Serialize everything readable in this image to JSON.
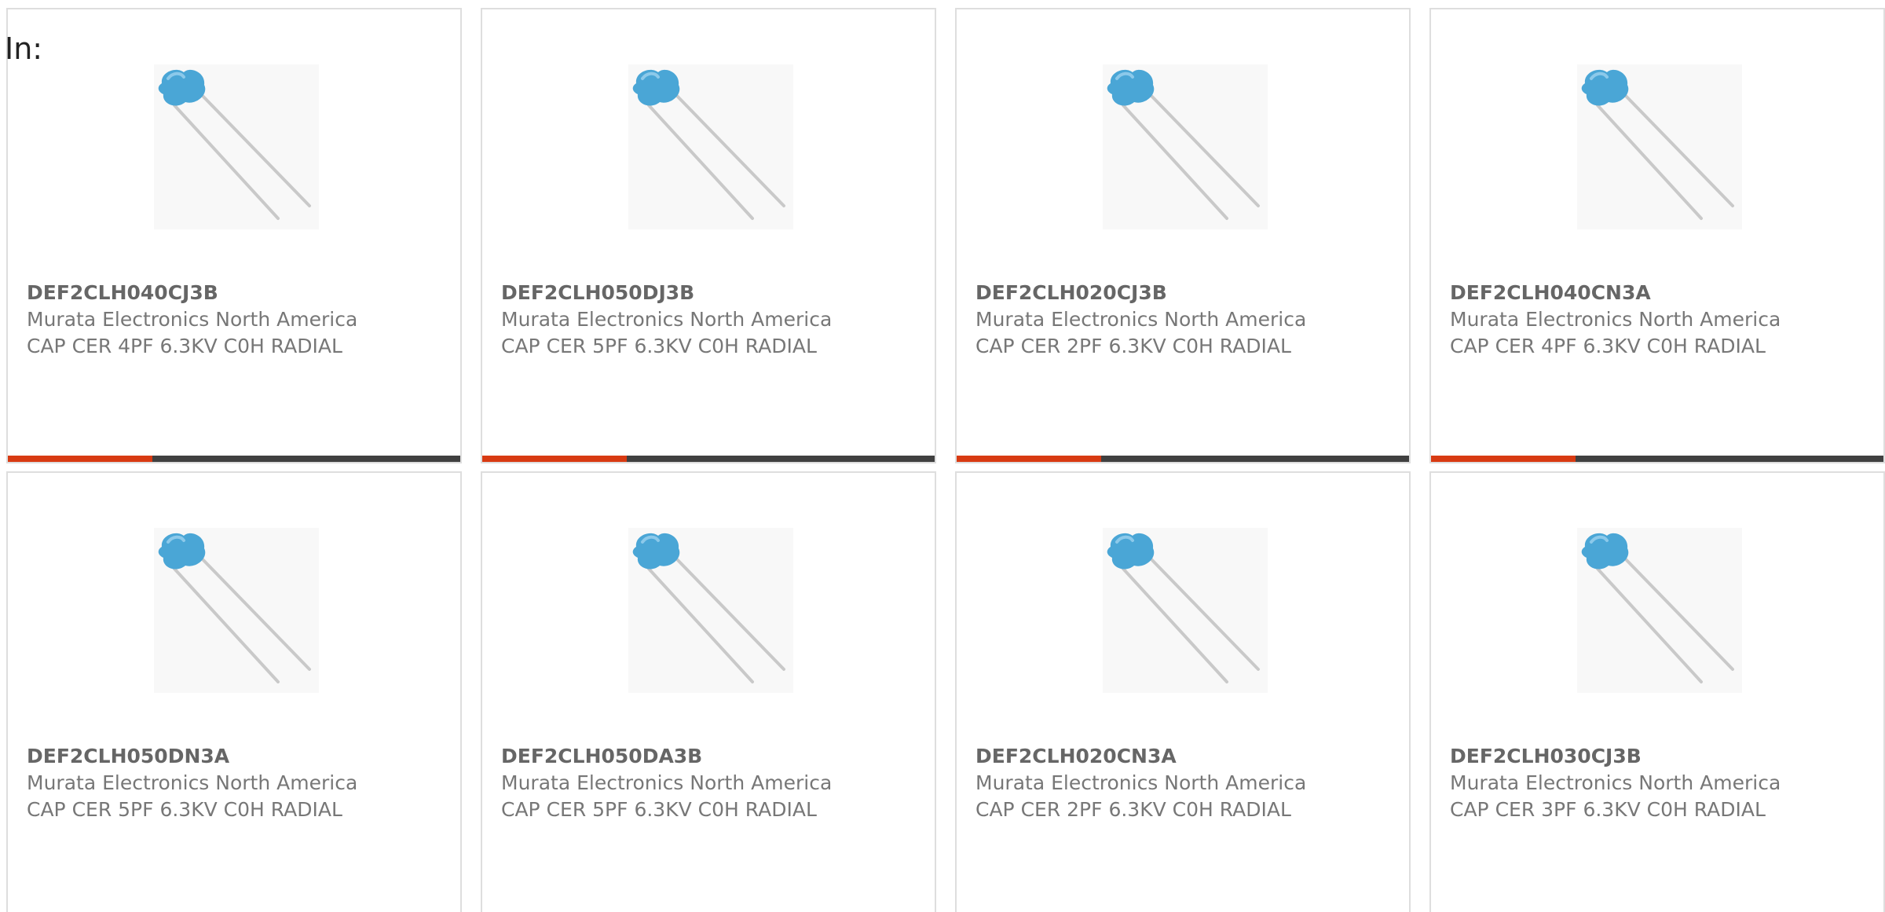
{
  "filter_label": "In:",
  "colors": {
    "accent": "#d83a12",
    "bar": "#404040",
    "capacitor_body": "#4aa6d6",
    "leads": "#c9c9c9"
  },
  "image_icon": "ceramic-disc-capacitor",
  "products": [
    {
      "part_number": "DEF2CLH040CJ3B",
      "manufacturer": "Murata Electronics North America",
      "description": "CAP CER 4PF 6.3KV C0H RADIAL",
      "accent_fraction": 0.32
    },
    {
      "part_number": "DEF2CLH050DJ3B",
      "manufacturer": "Murata Electronics North America",
      "description": "CAP CER 5PF 6.3KV C0H RADIAL",
      "accent_fraction": 0.32
    },
    {
      "part_number": "DEF2CLH020CJ3B",
      "manufacturer": "Murata Electronics North America",
      "description": "CAP CER 2PF 6.3KV C0H RADIAL",
      "accent_fraction": 0.32
    },
    {
      "part_number": "DEF2CLH040CN3A",
      "manufacturer": "Murata Electronics North America",
      "description": "CAP CER 4PF 6.3KV C0H RADIAL",
      "accent_fraction": 0.32
    },
    {
      "part_number": "DEF2CLH050DN3A",
      "manufacturer": "Murata Electronics North America",
      "description": "CAP CER 5PF 6.3KV C0H RADIAL",
      "accent_fraction": 0.32
    },
    {
      "part_number": "DEF2CLH050DA3B",
      "manufacturer": "Murata Electronics North America",
      "description": "CAP CER 5PF 6.3KV C0H RADIAL",
      "accent_fraction": 0.32
    },
    {
      "part_number": "DEF2CLH020CN3A",
      "manufacturer": "Murata Electronics North America",
      "description": "CAP CER 2PF 6.3KV C0H RADIAL",
      "accent_fraction": 0.32
    },
    {
      "part_number": "DEF2CLH030CJ3B",
      "manufacturer": "Murata Electronics North America",
      "description": "CAP CER 3PF 6.3KV C0H RADIAL",
      "accent_fraction": 0.32
    }
  ]
}
